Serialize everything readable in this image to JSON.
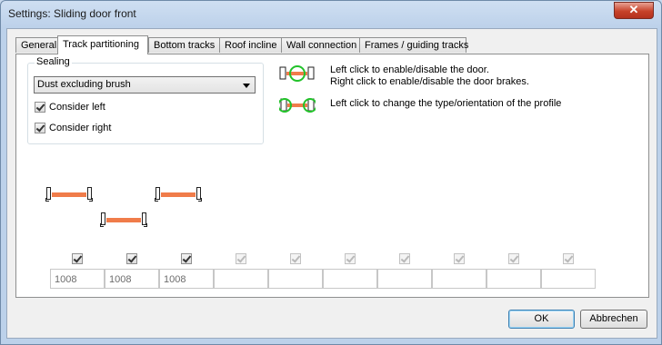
{
  "window": {
    "title": "Settings: Sliding door front",
    "close_glyph": "✕"
  },
  "tabs": [
    {
      "label": "General",
      "active": false
    },
    {
      "label": "Track partitioning",
      "active": true
    },
    {
      "label": "Bottom tracks",
      "active": false
    },
    {
      "label": "Roof incline",
      "active": false
    },
    {
      "label": "Wall connection",
      "active": false
    },
    {
      "label": "Frames / guiding tracks",
      "active": false
    }
  ],
  "sealing": {
    "group_label": "Sealing",
    "selected": "Dust excluding brush",
    "consider_left": {
      "label": "Consider left",
      "checked": true
    },
    "consider_right": {
      "label": "Consider right",
      "checked": true
    }
  },
  "help": {
    "line1": "Left click to enable/disable the door.",
    "line2": "Right click to enable/disable the door brakes.",
    "line3": "Left click to change the type/orientation of the profile",
    "accent_green": "#22c22a",
    "door_orange": "#f07c4a"
  },
  "columns": [
    {
      "checked": true,
      "enabled": true,
      "value": "1008"
    },
    {
      "checked": true,
      "enabled": true,
      "value": "1008"
    },
    {
      "checked": true,
      "enabled": true,
      "value": "1008"
    },
    {
      "checked": true,
      "enabled": false,
      "value": ""
    },
    {
      "checked": true,
      "enabled": false,
      "value": ""
    },
    {
      "checked": true,
      "enabled": false,
      "value": ""
    },
    {
      "checked": true,
      "enabled": false,
      "value": ""
    },
    {
      "checked": true,
      "enabled": false,
      "value": ""
    },
    {
      "checked": true,
      "enabled": false,
      "value": ""
    },
    {
      "checked": true,
      "enabled": false,
      "value": ""
    }
  ],
  "buttons": {
    "ok": "OK",
    "cancel": "Abbrechen"
  }
}
